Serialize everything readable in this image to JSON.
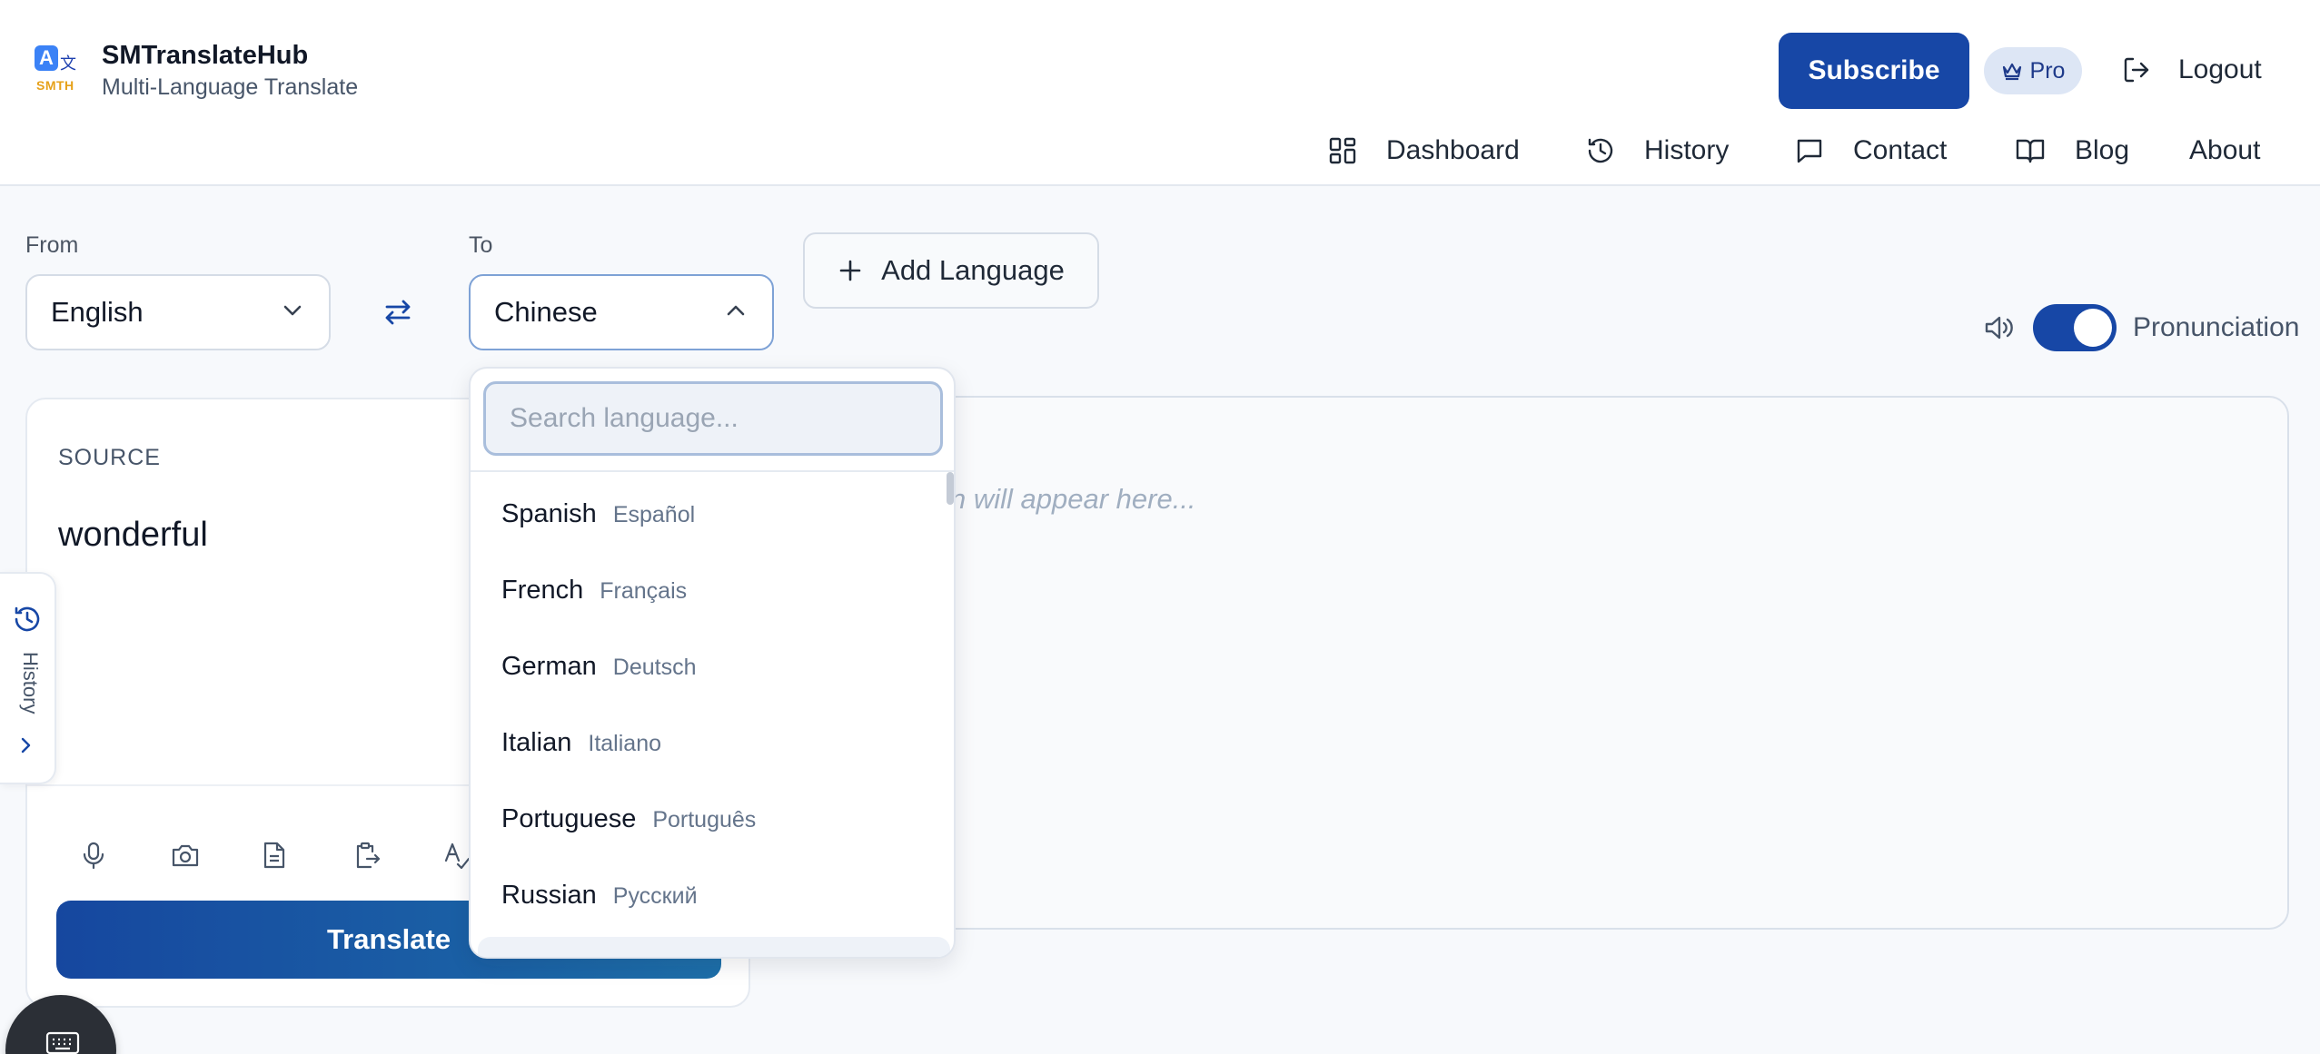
{
  "brand": {
    "logo_letter": "A",
    "logo_glyph": "文",
    "logo_text": "SMTH",
    "name": "SMTranslateHub",
    "tagline": "Multi-Language Translate"
  },
  "header": {
    "subscribe_label": "Subscribe",
    "pro_label": "Pro",
    "logout_label": "Logout"
  },
  "nav": {
    "items": [
      {
        "label": "Dashboard",
        "icon": "dashboard-icon"
      },
      {
        "label": "History",
        "icon": "history-icon"
      },
      {
        "label": "Contact",
        "icon": "message-icon"
      },
      {
        "label": "Blog",
        "icon": "book-icon"
      },
      {
        "label": "About",
        "icon": ""
      }
    ]
  },
  "languages": {
    "from_label": "From",
    "from_value": "English",
    "to_label": "To",
    "to_value": "Chinese",
    "add_language_label": "Add Language",
    "pronunciation_label": "Pronunciation",
    "pronunciation_on": true
  },
  "source": {
    "label": "SOURCE",
    "text": "wonderful",
    "tools": [
      "microphone-icon",
      "camera-icon",
      "document-icon",
      "paste-icon",
      "spell-check-icon"
    ],
    "translate_label": "Translate"
  },
  "target": {
    "placeholder_visible": "n will appear here..."
  },
  "history_tab": {
    "label": "History"
  },
  "dropdown": {
    "search_placeholder": "Search language...",
    "items": [
      {
        "name": "Spanish",
        "native": "Español"
      },
      {
        "name": "French",
        "native": "Français"
      },
      {
        "name": "German",
        "native": "Deutsch"
      },
      {
        "name": "Italian",
        "native": "Italiano"
      },
      {
        "name": "Portuguese",
        "native": "Português"
      },
      {
        "name": "Russian",
        "native": "Русский"
      }
    ]
  },
  "colors": {
    "primary": "#1747a6",
    "badge_bg": "#dde6f5",
    "page_bg": "#f7f9fc"
  }
}
